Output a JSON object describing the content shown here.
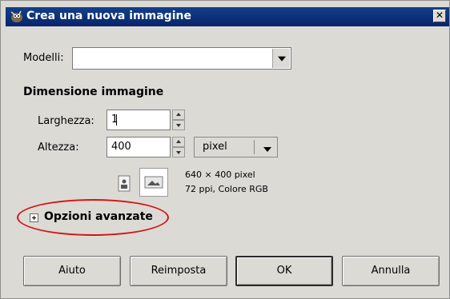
{
  "titlebar": {
    "title": "Crea una nuova immagine",
    "close_glyph": "✕"
  },
  "models": {
    "label": "Modelli:",
    "value": ""
  },
  "dimension": {
    "heading": "Dimensione immagine",
    "width_label": "Larghezza:",
    "width_value": "1",
    "height_label": "Altezza:",
    "height_value": "400",
    "unit": "pixel"
  },
  "info": {
    "size": "640 × 400 pixel",
    "resolution": "72 ppi, Colore RGB"
  },
  "advanced": {
    "label": "Opzioni avanzate"
  },
  "buttons": {
    "help": "Aiuto",
    "reset": "Reimposta",
    "ok": "OK",
    "cancel": "Annulla"
  },
  "colors": {
    "title_bar": "#0a246a",
    "dialog_bg": "#dcdad5",
    "highlight_ellipse": "#d41414"
  }
}
